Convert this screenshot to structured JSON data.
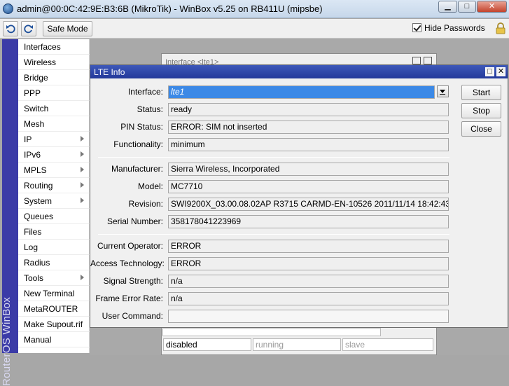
{
  "window": {
    "title": "admin@00:0C:42:9E:B3:6B (MikroTik) - WinBox v5.25 on RB411U (mipsbe)"
  },
  "toolbar": {
    "safe_mode_label": "Safe Mode",
    "hide_passwords_label": "Hide Passwords",
    "hide_passwords_checked": true
  },
  "side_strip": {
    "text": "RouterOS WinBox"
  },
  "menu": {
    "items": [
      {
        "label": "Interfaces",
        "submenu": false
      },
      {
        "label": "Wireless",
        "submenu": false
      },
      {
        "label": "Bridge",
        "submenu": false
      },
      {
        "label": "PPP",
        "submenu": false
      },
      {
        "label": "Switch",
        "submenu": false
      },
      {
        "label": "Mesh",
        "submenu": false
      },
      {
        "label": "IP",
        "submenu": true
      },
      {
        "label": "IPv6",
        "submenu": true
      },
      {
        "label": "MPLS",
        "submenu": true
      },
      {
        "label": "Routing",
        "submenu": true
      },
      {
        "label": "System",
        "submenu": true
      },
      {
        "label": "Queues",
        "submenu": false
      },
      {
        "label": "Files",
        "submenu": false
      },
      {
        "label": "Log",
        "submenu": false
      },
      {
        "label": "Radius",
        "submenu": false
      },
      {
        "label": "Tools",
        "submenu": true
      },
      {
        "label": "New Terminal",
        "submenu": false
      },
      {
        "label": "MetaROUTER",
        "submenu": false
      },
      {
        "label": "Make Supout.rif",
        "submenu": false
      },
      {
        "label": "Manual",
        "submenu": false
      }
    ]
  },
  "background_window": {
    "title": "Interface <lte1>",
    "status_fields": [
      "disabled",
      "running",
      "slave"
    ]
  },
  "dialog": {
    "title": "LTE Info",
    "interface": {
      "label": "Interface:",
      "value": "lte1"
    },
    "status": {
      "label": "Status:",
      "value": "ready"
    },
    "pin_status": {
      "label": "PIN Status:",
      "value": "ERROR: SIM not inserted"
    },
    "functionality": {
      "label": "Functionality:",
      "value": "minimum"
    },
    "manufacturer": {
      "label": "Manufacturer:",
      "value": "Sierra Wireless, Incorporated"
    },
    "model": {
      "label": "Model:",
      "value": "MC7710"
    },
    "revision": {
      "label": "Revision:",
      "value": "SWI9200X_03.00.08.02AP R3715 CARMD-EN-10526 2011/11/14 18:42:43"
    },
    "serial_number": {
      "label": "Serial Number:",
      "value": "358178041223969"
    },
    "current_operator": {
      "label": "Current Operator:",
      "value": "ERROR"
    },
    "access_technology": {
      "label": "Access Technology:",
      "value": "ERROR"
    },
    "signal_strength": {
      "label": "Signal Strength:",
      "value": "n/a"
    },
    "frame_error_rate": {
      "label": "Frame Error Rate:",
      "value": "n/a"
    },
    "user_command": {
      "label": "User Command:",
      "value": ""
    },
    "buttons": {
      "start": "Start",
      "stop": "Stop",
      "close": "Close"
    }
  }
}
